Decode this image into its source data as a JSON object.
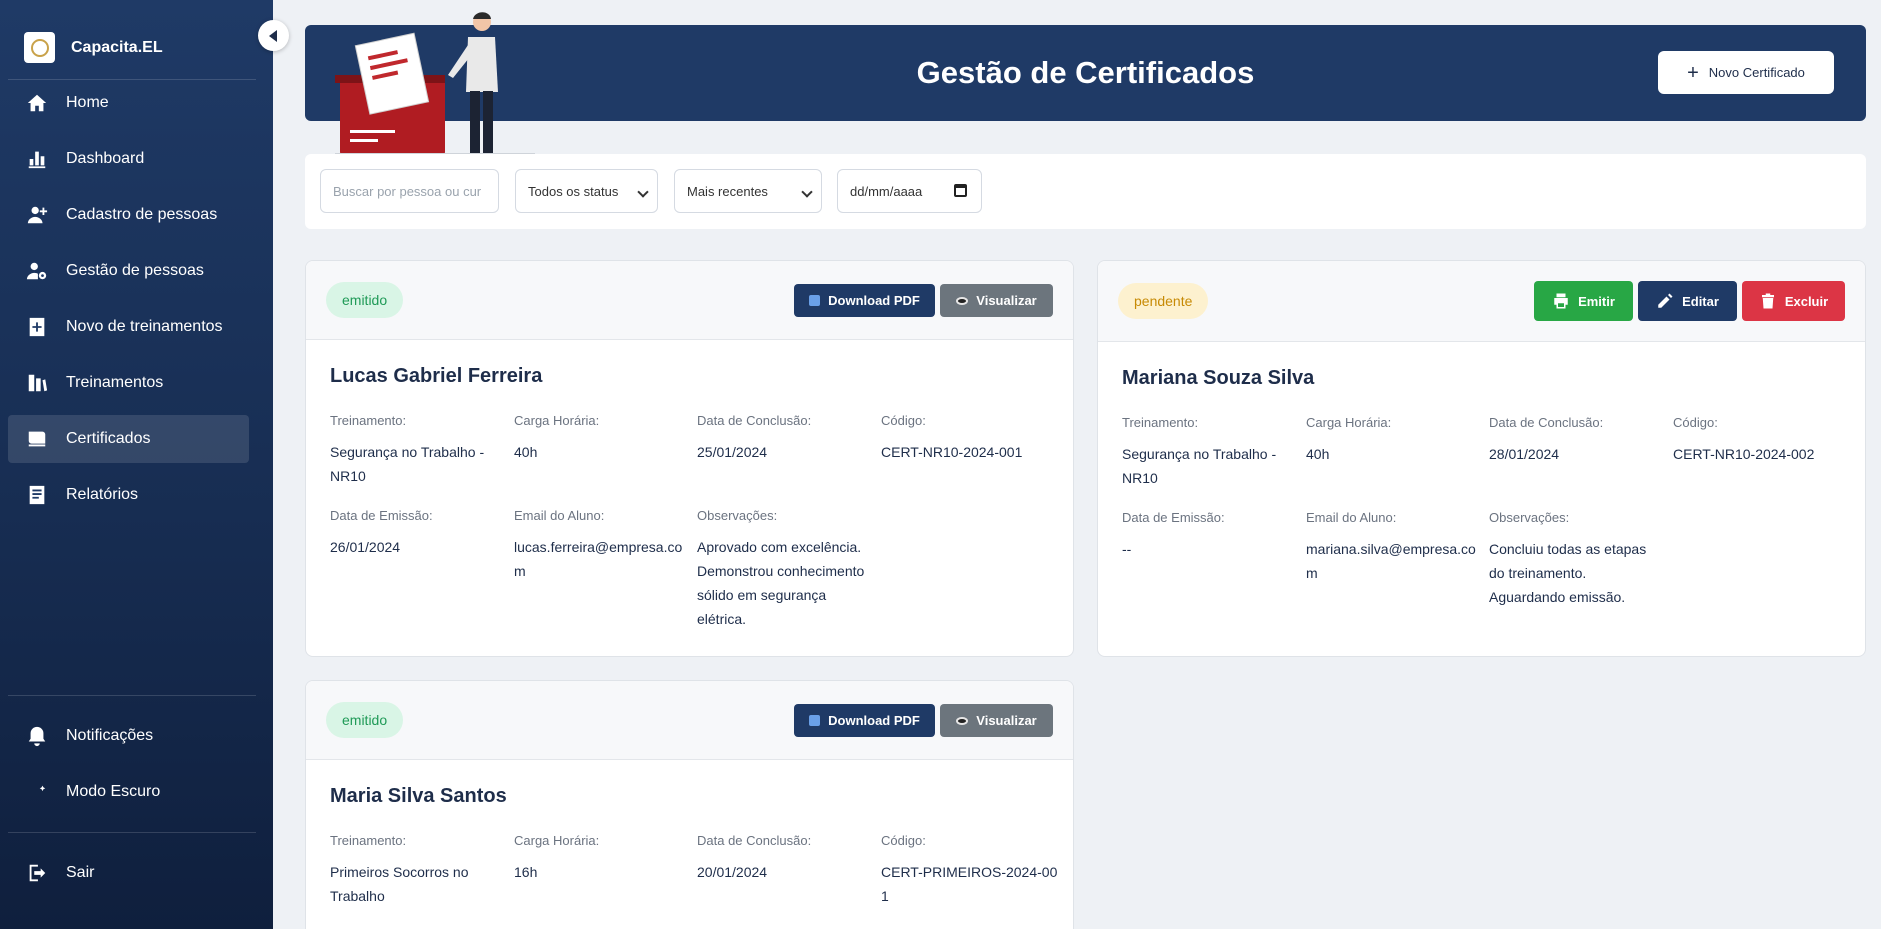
{
  "sidebar": {
    "brand": "Capacita.EL",
    "items": [
      {
        "label": "Home",
        "icon": "home-icon"
      },
      {
        "label": "Dashboard",
        "icon": "bar-chart-icon"
      },
      {
        "label": "Cadastro de pessoas",
        "icon": "user-add-icon"
      },
      {
        "label": "Gestão de pessoas",
        "icon": "user-gear-icon"
      },
      {
        "label": "Novo de treinamentos",
        "icon": "plus-document-icon"
      },
      {
        "label": "Treinamentos",
        "icon": "books-icon"
      },
      {
        "label": "Certificados",
        "icon": "certificate-icon"
      },
      {
        "label": "Relatórios",
        "icon": "report-icon"
      }
    ],
    "bottom_items": [
      {
        "label": "Notificações",
        "icon": "bell-icon"
      },
      {
        "label": "Modo Escuro",
        "icon": "moon-icon"
      }
    ],
    "logout": {
      "label": "Sair",
      "icon": "logout-icon"
    },
    "active": "Certificados"
  },
  "header": {
    "title": "Gestão de Certificados",
    "new_button": "Novo Certificado"
  },
  "filters": {
    "search_placeholder": "Buscar por pessoa ou cur",
    "status_value": "Todos os status",
    "sort_value": "Mais recentes",
    "date_placeholder": "dd/mm/aaaa"
  },
  "labels": {
    "training": "Treinamento:",
    "hours": "Carga Horária:",
    "completion": "Data de Conclusão:",
    "code": "Código:",
    "issue": "Data de Emissão:",
    "email": "Email do Aluno:",
    "notes": "Observações:"
  },
  "buttons": {
    "download": "Download PDF",
    "view": "Visualizar",
    "issue": "Emitir",
    "edit": "Editar",
    "delete": "Excluir"
  },
  "certificates": [
    {
      "status": "emitido",
      "name": "Lucas Gabriel Ferreira",
      "training": "Segurança no Trabalho - NR10",
      "hours": "40h",
      "completion": "25/01/2024",
      "code": "CERT-NR10-2024-001",
      "issue_date": "26/01/2024",
      "email": "lucas.ferreira@empresa.com",
      "notes": "Aprovado com excelência. Demonstrou conhecimento sólido em segurança elétrica."
    },
    {
      "status": "pendente",
      "name": "Mariana Souza Silva",
      "training": "Segurança no Trabalho - NR10",
      "hours": "40h",
      "completion": "28/01/2024",
      "code": "CERT-NR10-2024-002",
      "issue_date": "--",
      "email": "mariana.silva@empresa.com",
      "notes": "Concluiu todas as etapas do treinamento. Aguardando emissão."
    },
    {
      "status": "emitido",
      "name": "Maria Silva Santos",
      "training": "Primeiros Socorros no Trabalho",
      "hours": "16h",
      "completion": "20/01/2024",
      "code": "CERT-PRIMEIROS-2024-001"
    }
  ],
  "colors": {
    "primary": "#1f3a66",
    "success": "#28a745",
    "danger": "#dc3545",
    "badge_emitido": "#d9f5e6",
    "badge_pendente": "#fdf1cf"
  }
}
